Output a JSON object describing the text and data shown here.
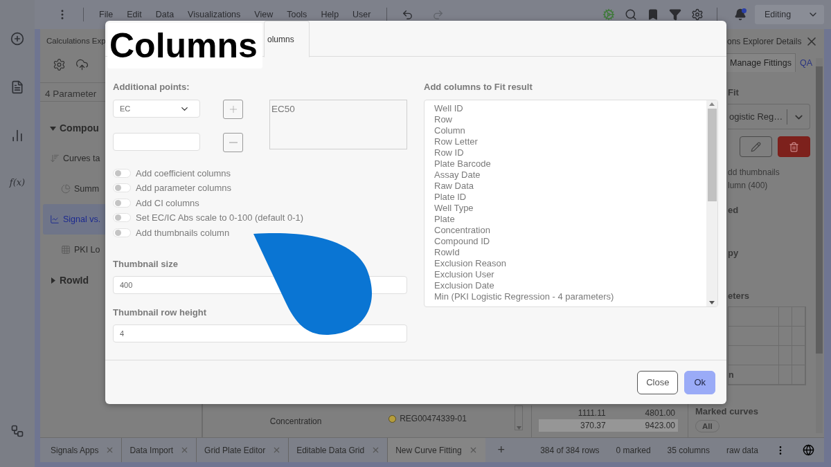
{
  "top_bar": {
    "menus": [
      "File",
      "Edit",
      "Data",
      "Visualizations",
      "View",
      "Tools",
      "Help",
      "User"
    ],
    "undo": {
      "disabled": false
    },
    "redo": {
      "disabled": true
    },
    "notifications": {
      "unread": true
    },
    "mode": "Editing"
  },
  "rail": {
    "formula_label": "f(x)"
  },
  "left_panel": {
    "title": "Calculations Exp",
    "subtitle": "4 Parameter",
    "tree": [
      {
        "label": "Compou",
        "kind": "group",
        "expanded": true,
        "selected": false,
        "children": [
          {
            "label": "Curves ta",
            "kind": "sort",
            "selected": false,
            "children": [
              {
                "label": "Summ",
                "kind": "pie",
                "selected": false
              }
            ]
          },
          {
            "label": "Signal vs.",
            "kind": "line",
            "selected": true,
            "children": [
              {
                "label": "PKI Lo",
                "kind": "grid",
                "selected": false
              }
            ]
          }
        ]
      },
      {
        "label": "RowId",
        "kind": "group",
        "expanded": false,
        "selected": false
      }
    ]
  },
  "middle_strip": {
    "label": "Concentration",
    "items": [
      {
        "label": "REG00474339-01",
        "color": "#b59d3c"
      }
    ],
    "rows": [
      {
        "cells": [
          "1111.11",
          "4801.00"
        ],
        "selected": false
      },
      {
        "cells": [
          "370.37",
          "9423.00"
        ],
        "selected": true
      }
    ]
  },
  "right_panel": {
    "title": "ons Explorer Details",
    "tabs": [
      {
        "label": "Manage Fittings",
        "selected": true
      },
      {
        "label": "QA",
        "selected": false
      }
    ],
    "fit_label": "Fit",
    "fit_select": "ogistic Reg…",
    "note_lines": [
      "dd thumbnails",
      "lumn (400)"
    ],
    "headings": [
      "ed",
      "py",
      "eters"
    ],
    "params_table": {
      "last_row_text": "n"
    },
    "marked_curves": "Marked curves",
    "marked_filter": "All"
  },
  "bottom_tabs": {
    "tabs": [
      {
        "label": "Signals Apps",
        "selected": false
      },
      {
        "label": "Data Import",
        "selected": false
      },
      {
        "label": "Grid Plate Editor",
        "selected": false
      },
      {
        "label": "Editable Data Grid",
        "selected": false
      },
      {
        "label": "New Curve Fitting",
        "selected": true
      }
    ],
    "add": "+",
    "status": [
      "384 of 384 rows",
      "0 marked",
      "35 columns",
      "raw data"
    ]
  },
  "dialog": {
    "annotation": "Columns",
    "tab": {
      "label": "olumns",
      "selected": true
    },
    "points_label": "Additional points:",
    "points_select": "EC",
    "points_list": [
      "EC50"
    ],
    "toggles": [
      {
        "label": "Add coefficient columns",
        "on": false
      },
      {
        "label": "Add parameter columns",
        "on": false
      },
      {
        "label": "Add CI columns",
        "on": false
      },
      {
        "label": "Set EC/IC Abs scale to 0-100 (default 0-1)",
        "on": false
      },
      {
        "label": "Add thumbnails column",
        "on": false
      }
    ],
    "thumbnail_size": {
      "label": "Thumbnail size",
      "value": "400"
    },
    "thumbnail_row_height": {
      "label": "Thumbnail row height",
      "value": "4"
    },
    "columns_label": "Add columns to Fit result",
    "columns": [
      "Well ID",
      "Row",
      "Column",
      "Row Letter",
      "Row ID",
      "Plate Barcode",
      "Assay Date",
      "Raw Data",
      "Plate ID",
      "Well Type",
      "Plate",
      "Concentration",
      "Compound ID",
      "RowId",
      "Exclusion Reason",
      "Exclusion User",
      "Exclusion Date",
      "Min (PKI Logistic Regression - 4 parameters)"
    ],
    "buttons": [
      {
        "label": "Close",
        "kind": "secondary"
      },
      {
        "label": "Ok",
        "kind": "primary"
      }
    ]
  }
}
